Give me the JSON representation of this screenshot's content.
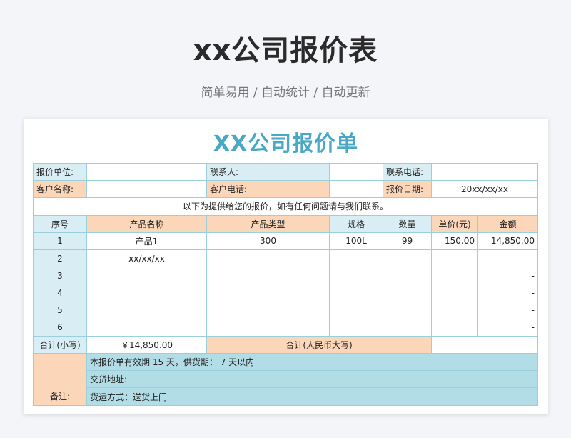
{
  "page": {
    "title": "xx公司报价表",
    "subtitle": "简单易用 / 自动统计 / 自动更新"
  },
  "sheet": {
    "title": "XX公司报价单",
    "info": {
      "quote_unit_label": "报价单位:",
      "quote_unit_value": "",
      "contact_label": "联系人:",
      "contact_value": "",
      "contact_phone_label": "联系电话:",
      "contact_phone_value": "",
      "customer_name_label": "客户名称:",
      "customer_name_value": "",
      "customer_phone_label": "客户电话:",
      "customer_phone_value": "",
      "quote_date_label": "报价日期:",
      "quote_date_value": "20xx/xx/xx"
    },
    "intro": "以下为提供给您的报价，如有任何问题请与我们联系。",
    "columns": [
      "序号",
      "产品名称",
      "产品类型",
      "规格",
      "数量",
      "单价(元)",
      "金额"
    ],
    "rows": [
      [
        "1",
        "产品1",
        "300",
        "100L",
        "99",
        "150.00",
        "14,850.00"
      ],
      [
        "2",
        "xx/xx/xx",
        "",
        "",
        "",
        "",
        "-"
      ],
      [
        "3",
        "",
        "",
        "",
        "",
        "",
        "-"
      ],
      [
        "4",
        "",
        "",
        "",
        "",
        "",
        "-"
      ],
      [
        "5",
        "",
        "",
        "",
        "",
        "",
        "-"
      ],
      [
        "6",
        "",
        "",
        "",
        "",
        "",
        "-"
      ]
    ],
    "total": {
      "lower_label": "合计(小写)",
      "lower_value": "￥14,850.00",
      "upper_label": "合计(人民币大写)",
      "upper_value": ""
    },
    "notes": {
      "label": "备注:",
      "lines": [
        "本报价单有效期 15 天，供货期： 7 天以内",
        "交货地址:",
        "货运方式：送货上门"
      ]
    }
  }
}
